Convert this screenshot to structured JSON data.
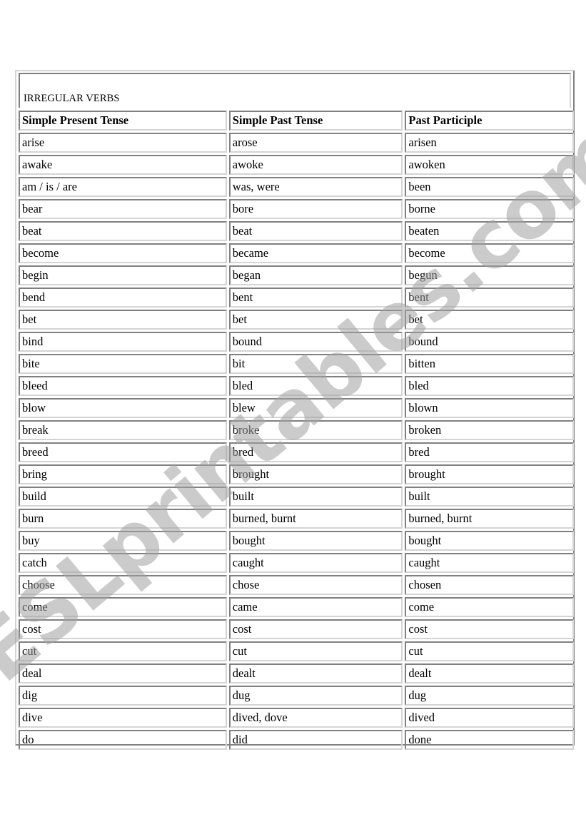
{
  "document": {
    "title": "IRREGULAR VERBS",
    "watermark": "ESLprintables.com",
    "colors": {
      "border_dark": "#808080",
      "border_light": "#d4d4d4",
      "watermark": "#c0c0c0"
    }
  },
  "table": {
    "headers": [
      "Simple Present Tense",
      "Simple Past Tense",
      "Past Participle"
    ],
    "rows": [
      [
        "arise",
        "arose",
        "arisen"
      ],
      [
        "awake",
        "awoke",
        "awoken"
      ],
      [
        "am / is / are",
        "was, were",
        "been"
      ],
      [
        "bear",
        "bore",
        "borne"
      ],
      [
        "beat",
        "beat",
        "beaten"
      ],
      [
        "become",
        "became",
        "become"
      ],
      [
        "begin",
        "began",
        "begun"
      ],
      [
        "bend",
        "bent",
        "bent"
      ],
      [
        "bet",
        "bet",
        "bet"
      ],
      [
        "bind",
        "bound",
        "bound"
      ],
      [
        "bite",
        "bit",
        "bitten"
      ],
      [
        "bleed",
        "bled",
        "bled"
      ],
      [
        "blow",
        "blew",
        "blown"
      ],
      [
        "break",
        "broke",
        "broken"
      ],
      [
        "breed",
        "bred",
        "bred"
      ],
      [
        "bring",
        "brought",
        "brought"
      ],
      [
        "build",
        "built",
        "built"
      ],
      [
        "burn",
        "burned, burnt",
        "burned, burnt"
      ],
      [
        "buy",
        "bought",
        "bought"
      ],
      [
        "catch",
        "caught",
        "caught"
      ],
      [
        "choose",
        "chose",
        "chosen"
      ],
      [
        "come",
        "came",
        "come"
      ],
      [
        "cost",
        "cost",
        "cost"
      ],
      [
        "cut",
        "cut",
        "cut"
      ],
      [
        "deal",
        "dealt",
        "dealt"
      ],
      [
        "dig",
        "dug",
        "dug"
      ],
      [
        "dive",
        "dived, dove",
        "dived"
      ],
      [
        "do",
        "did",
        "done"
      ]
    ]
  }
}
